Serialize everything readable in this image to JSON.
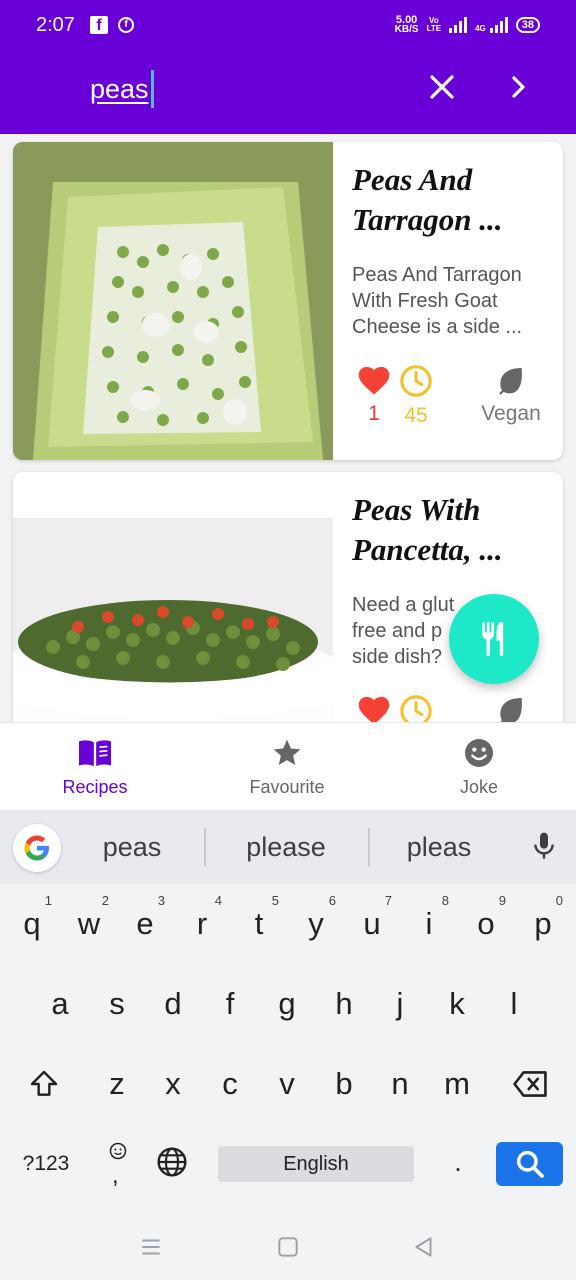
{
  "status_bar": {
    "time": "2:07",
    "network_speed_value": "5.00",
    "network_speed_unit": "KB/S",
    "volte_line1": "Vo",
    "volte_line2": "LTE",
    "network_type": "4G",
    "battery": "38",
    "icons": [
      "facebook-icon",
      "facebook-messenger-icon",
      "signal-icon",
      "wifi-icon"
    ]
  },
  "app_bar": {
    "search_value": "peas",
    "icons": [
      "close-icon",
      "chevron-right-icon"
    ],
    "accent_color": "#6a00d8"
  },
  "recipes": [
    {
      "title_line1": "Peas And",
      "title_line2": "Tarragon ...",
      "desc_line1": "Peas And Tarragon",
      "desc_line2": "With Fresh Goat",
      "desc_line3": "Cheese is a side ...",
      "likes": "1",
      "minutes": "45",
      "diet": "Vegan"
    },
    {
      "title_line1": "Peas With",
      "title_line2": "Pancetta, ...",
      "desc_line1": "Need a glut",
      "desc_line2": "free and p",
      "desc_line3": "side dish?"
    }
  ],
  "fab": {
    "icon": "restaurant-icon",
    "color": "#1de9c8"
  },
  "bottom_nav": [
    {
      "label": "Recipes",
      "icon": "book-icon",
      "active": true
    },
    {
      "label": "Favourite",
      "icon": "star-icon",
      "active": false
    },
    {
      "label": "Joke",
      "icon": "smiley-icon",
      "active": false
    }
  ],
  "keyboard": {
    "suggestions": [
      "peas",
      "please",
      "pleas"
    ],
    "row1": [
      "q",
      "w",
      "e",
      "r",
      "t",
      "y",
      "u",
      "i",
      "o",
      "p"
    ],
    "row1_hints": [
      "1",
      "2",
      "3",
      "4",
      "5",
      "6",
      "7",
      "8",
      "9",
      "0"
    ],
    "row2": [
      "a",
      "s",
      "d",
      "f",
      "g",
      "h",
      "j",
      "k",
      "l"
    ],
    "row3": [
      "z",
      "x",
      "c",
      "v",
      "b",
      "n",
      "m"
    ],
    "symbols_label": "?123",
    "comma_label": ",",
    "space_label": "English",
    "period_label": ".",
    "icons": [
      "google-icon",
      "microphone-icon",
      "shift-icon",
      "backspace-icon",
      "emoji-icon",
      "globe-icon",
      "search-icon"
    ]
  },
  "system_nav": {
    "icons": [
      "recent-apps-icon",
      "home-icon",
      "back-icon"
    ]
  }
}
